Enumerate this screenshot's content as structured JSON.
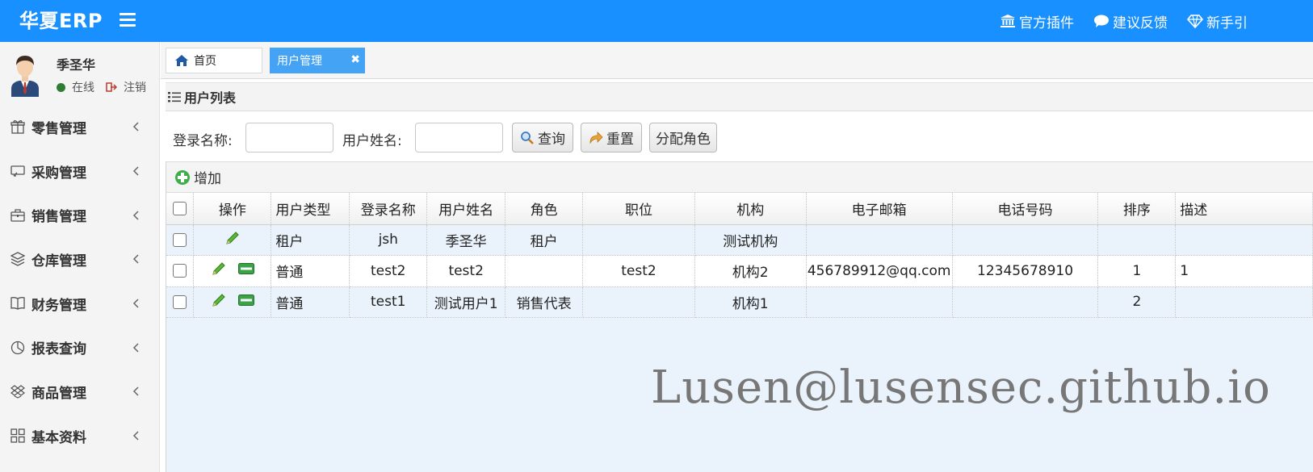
{
  "header": {
    "logo": "华夏ERP",
    "links": [
      {
        "icon": "bank-icon",
        "label": "官方插件"
      },
      {
        "icon": "comment-icon",
        "label": "建议反馈"
      },
      {
        "icon": "diamond-icon",
        "label": "新手引"
      }
    ]
  },
  "user": {
    "name": "季圣华",
    "status": "在线",
    "logout": "注销"
  },
  "sidebar": {
    "items": [
      {
        "icon": "gift-icon",
        "label": "零售管理"
      },
      {
        "icon": "purchase-icon",
        "label": "采购管理"
      },
      {
        "icon": "briefcase-icon",
        "label": "销售管理"
      },
      {
        "icon": "layers-icon",
        "label": "仓库管理"
      },
      {
        "icon": "book-icon",
        "label": "财务管理"
      },
      {
        "icon": "pie-chart-icon",
        "label": "报表查询"
      },
      {
        "icon": "dropbox-icon",
        "label": "商品管理"
      },
      {
        "icon": "grid-icon",
        "label": "基本资料"
      }
    ]
  },
  "tabs": {
    "home": "首页",
    "active": "用户管理",
    "close": "✖"
  },
  "panel": {
    "title": "用户列表"
  },
  "search": {
    "login_label": "登录名称:",
    "login_value": "",
    "name_label": "用户姓名:",
    "name_value": "",
    "query": "查询",
    "reset": "重置",
    "assign": "分配角色"
  },
  "toolbar": {
    "add": "增加"
  },
  "table": {
    "columns": [
      "操作",
      "用户类型",
      "登录名称",
      "用户姓名",
      "角色",
      "职位",
      "机构",
      "电子邮箱",
      "电话号码",
      "排序",
      "描述"
    ],
    "rows": [
      {
        "type": "租户",
        "login": "jsh",
        "name": "季圣华",
        "role": "租户",
        "position": "",
        "org": "测试机构",
        "email": "",
        "phone": "",
        "sort": "",
        "desc": "",
        "has_delete": false
      },
      {
        "type": "普通",
        "login": "test2",
        "name": "test2",
        "role": "",
        "position": "test2",
        "org": "机构2",
        "email": "456789912@qq.com",
        "phone": "12345678910",
        "sort": "1",
        "desc": "1",
        "has_delete": true
      },
      {
        "type": "普通",
        "login": "test1",
        "name": "测试用户1",
        "role": "销售代表",
        "position": "",
        "org": "机构1",
        "email": "",
        "phone": "",
        "sort": "2",
        "desc": "",
        "has_delete": true
      }
    ]
  },
  "watermark": "Lusen@lusensec.github.io",
  "colors": {
    "header_bg": "#1890ff",
    "active_tab": "#45a3f5",
    "online_dot": "#2e7d32",
    "edit_icon": "#3c9a2a",
    "delete_icon": "#2e8b3a"
  }
}
